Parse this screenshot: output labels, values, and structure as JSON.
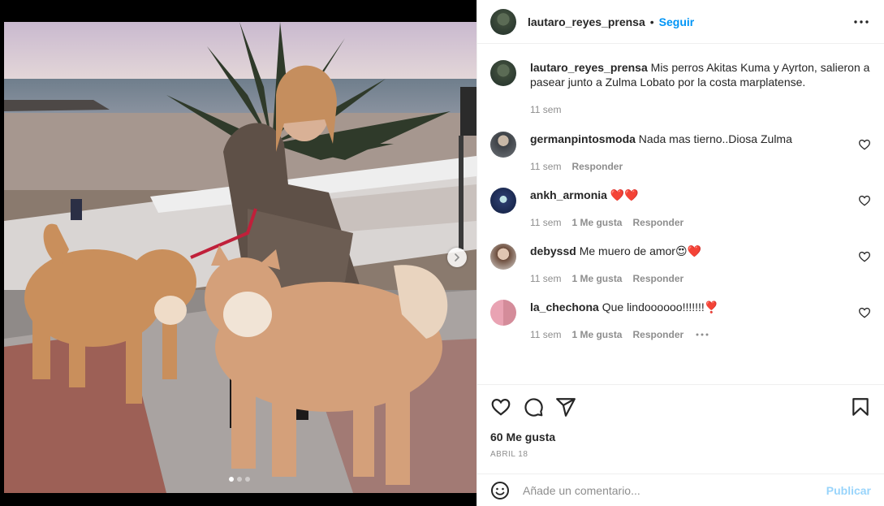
{
  "post": {
    "username": "lautaro_reyes_prensa",
    "follow_label": "Seguir",
    "caption_text": "Mis perros Akitas Kuma y Ayrton, salieron a pasear junto a Zulma Lobato por la costa marplatense.",
    "caption_time": "11 sem",
    "likes": "60 Me gusta",
    "date": "ABRIL 18",
    "carousel_count": 3,
    "carousel_active": 1
  },
  "comments": [
    {
      "username": "germanpintosmoda",
      "text": "Nada mas tierno..Diosa Zulma",
      "time": "11 sem",
      "likes": "",
      "reply": "Responder"
    },
    {
      "username": "ankh_armonia",
      "text": "❤️❤️",
      "time": "11 sem",
      "likes": "1 Me gusta",
      "reply": "Responder"
    },
    {
      "username": "debyssd",
      "text": "Me muero de amor😍❤️",
      "time": "11 sem",
      "likes": "1 Me gusta",
      "reply": "Responder"
    },
    {
      "username": "la_chechona",
      "text": "Que lindoooooo!!!!!!!❣️",
      "time": "11 sem",
      "likes": "1 Me gusta",
      "reply": "Responder"
    }
  ],
  "add_comment": {
    "placeholder": "Añade un comentario...",
    "publish_label": "Publicar"
  },
  "icons": {
    "more": "more-options-icon",
    "like": "heart-icon",
    "comment": "comment-icon",
    "share": "paper-plane-icon",
    "save": "bookmark-icon",
    "emoji": "emoji-icon",
    "next": "chevron-right-icon"
  },
  "colors": {
    "accent": "#0095f6",
    "secondary_text": "#8e8e8e",
    "border": "#efefef"
  }
}
